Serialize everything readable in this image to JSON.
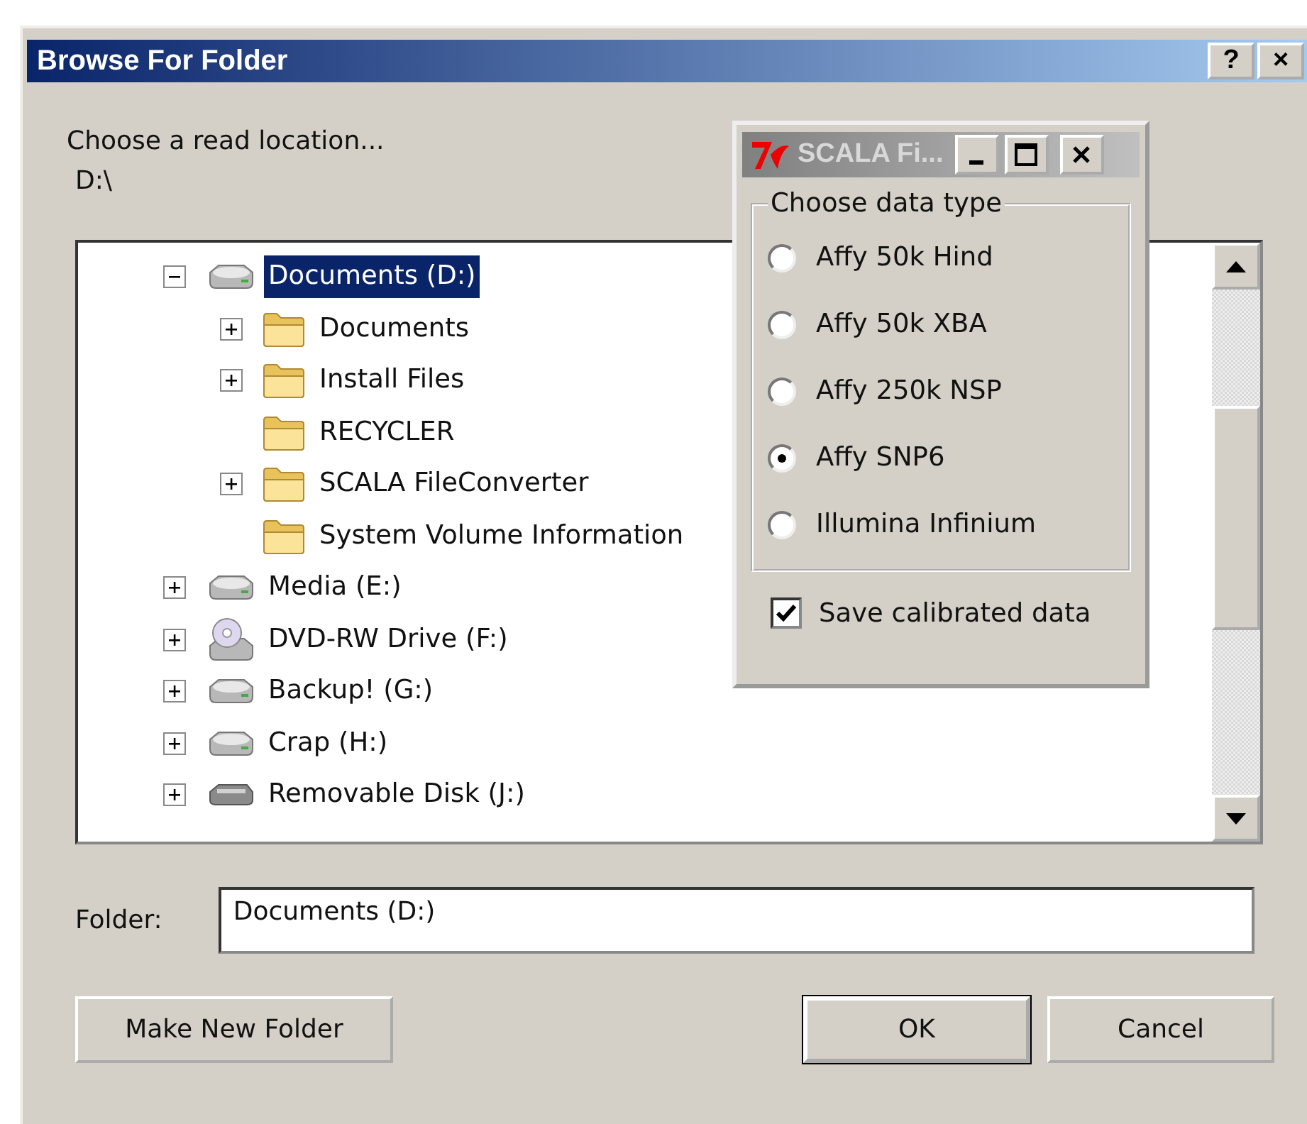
{
  "window": {
    "title": "Browse For Folder",
    "title_buttons": [
      "?",
      "×"
    ]
  },
  "prompt": "Choose a read location...",
  "path": "D:\\",
  "tree": {
    "items": [
      {
        "label": "Documents (D:)",
        "kind": "drive",
        "expandable": true,
        "expanded": true,
        "selected": true,
        "children": [
          {
            "label": "Documents",
            "kind": "folder",
            "expandable": true,
            "expanded": false,
            "selected": false
          },
          {
            "label": "Install Files",
            "kind": "folder",
            "expandable": true,
            "expanded": false,
            "selected": false
          },
          {
            "label": "RECYCLER",
            "kind": "folder",
            "expandable": false,
            "selected": false
          },
          {
            "label": "SCALA FileConverter",
            "kind": "folder",
            "expandable": true,
            "expanded": false,
            "selected": false
          },
          {
            "label": "System Volume Information",
            "kind": "folder",
            "expandable": false,
            "selected": false
          }
        ]
      },
      {
        "label": "Media (E:)",
        "kind": "drive",
        "expandable": true,
        "expanded": false,
        "selected": false
      },
      {
        "label": "DVD-RW Drive (F:)",
        "kind": "optical",
        "expandable": true,
        "expanded": false,
        "selected": false
      },
      {
        "label": "Backup! (G:)",
        "kind": "drive",
        "expandable": true,
        "expanded": false,
        "selected": false
      },
      {
        "label": "Crap (H:)",
        "kind": "drive",
        "expandable": true,
        "expanded": false,
        "selected": false
      },
      {
        "label": "Removable Disk (J:)",
        "kind": "removable",
        "expandable": true,
        "expanded": false,
        "selected": false
      }
    ]
  },
  "folder_field": {
    "label": "Folder:",
    "value": "Documents (D:)"
  },
  "buttons": [
    {
      "label": "Make New Folder",
      "default": false
    },
    {
      "label": "OK",
      "default": true
    },
    {
      "label": "Cancel",
      "default": false
    }
  ],
  "tk_window": {
    "title": "SCALA Fi...",
    "group_label": "Choose data type",
    "options": [
      {
        "label": "Affy 50k Hind",
        "selected": false
      },
      {
        "label": "Affy 50k XBA",
        "selected": false
      },
      {
        "label": "Affy 250k NSP",
        "selected": false
      },
      {
        "label": "Affy SNP6",
        "selected": true
      },
      {
        "label": "Illumina Infinium",
        "selected": false
      }
    ],
    "checkbox": {
      "label": "Save calibrated data",
      "checked": true
    }
  }
}
